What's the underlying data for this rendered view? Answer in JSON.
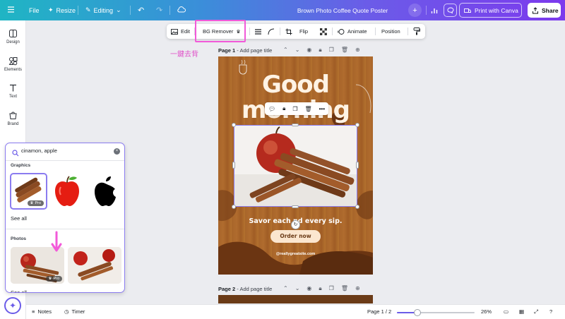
{
  "topbar": {
    "file_label": "File",
    "resize_label": "Resize",
    "editing_label": "Editing",
    "doc_title": "Brown Photo Coffee Quote Poster",
    "print_label": "Print with Canva",
    "share_label": "Share"
  },
  "sidebar": {
    "items": [
      {
        "label": "Design",
        "icon": "design-icon"
      },
      {
        "label": "Elements",
        "icon": "elements-icon"
      },
      {
        "label": "Text",
        "icon": "text-icon"
      },
      {
        "label": "Brand",
        "icon": "brand-icon"
      }
    ]
  },
  "search": {
    "query": "cinamon, apple",
    "graphics_label": "Graphics",
    "photos_label": "Photos",
    "see_all_label": "See all",
    "pro_label": "Pro"
  },
  "context_toolbar": {
    "edit_label": "Edit",
    "bg_remover_label": "BG Remover",
    "flip_label": "Flip",
    "animate_label": "Animate",
    "position_label": "Position"
  },
  "annotation": "一鍵去背",
  "pages": [
    {
      "prefix": "Page 1",
      "title_placeholder": "Add page title"
    },
    {
      "prefix": "Page 2",
      "title_placeholder": "Add page title"
    }
  ],
  "poster": {
    "line1": "Good",
    "line2": "morning",
    "tagline": "Savor each   nd every sip.",
    "button": "Order now",
    "website": "@reallygreatsite.com"
  },
  "bottombar": {
    "notes_label": "Notes",
    "timer_label": "Timer",
    "page_indicator": "Page 1 / 2",
    "zoom": "26%",
    "zoom_fraction": 0.26
  },
  "colors": {
    "accent": "#7c3aed",
    "highlight": "#f25ad9",
    "poster_brown": "#a8652a"
  }
}
